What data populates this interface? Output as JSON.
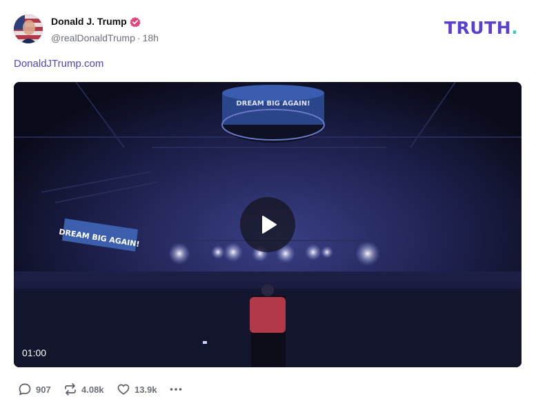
{
  "post": {
    "author_name": "Donald J. Trump",
    "handle": "@realDonaldTrump",
    "separator": "·",
    "time_ago": "18h",
    "link_text": "DonaldJTrump.com",
    "media": {
      "duration": "01:00",
      "signs": [
        "DREAM BIG AGAIN!",
        "DREAM BIG AGAIN!"
      ]
    },
    "stats": {
      "replies": "907",
      "retruths": "4.08k",
      "likes": "13.9k"
    }
  },
  "brand": {
    "logo_text": "TRUTH",
    "logo_dot": ".",
    "logo_color": "#5a3fd1",
    "dot_color": "#2bd3b3",
    "link_color": "#5442c9",
    "verified_color": "#e1457b"
  },
  "icons": {
    "verified": "verified-badge-icon",
    "play": "play-icon",
    "reply": "reply-icon",
    "retruth": "retruth-icon",
    "like": "heart-icon",
    "more": "more-icon"
  }
}
